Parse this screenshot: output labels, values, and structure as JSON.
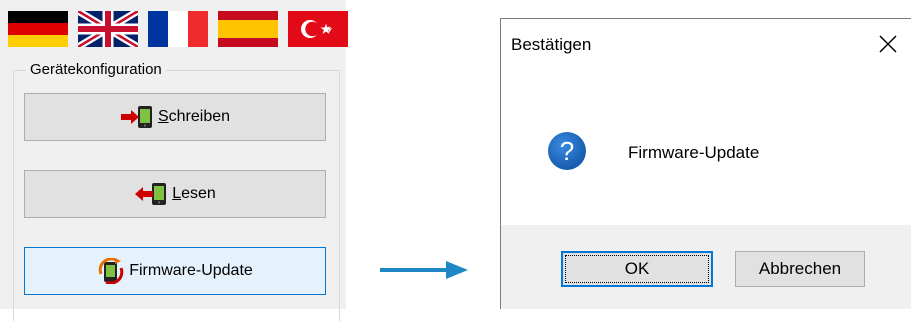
{
  "flags": [
    {
      "name": "flag-de-icon"
    },
    {
      "name": "flag-uk-icon"
    },
    {
      "name": "flag-fr-icon"
    },
    {
      "name": "flag-es-icon"
    },
    {
      "name": "flag-tr-icon"
    }
  ],
  "config": {
    "group_title": "Gerätekonfiguration",
    "write_button": {
      "mnemonic": "S",
      "rest": "chreiben",
      "icon": "write-to-device-icon"
    },
    "read_button": {
      "mnemonic": "L",
      "rest": "esen",
      "icon": "read-from-device-icon"
    },
    "firmware_button": {
      "label": "Firmware-Update",
      "icon": "firmware-update-icon"
    }
  },
  "dialog": {
    "title": "Bestätigen",
    "message": "Firmware-Update",
    "ok_label": "OK",
    "cancel_label": "Abbrechen",
    "icon": "question-icon"
  },
  "colors": {
    "accent": "#0078d7",
    "arrow": "#1e88c7"
  }
}
